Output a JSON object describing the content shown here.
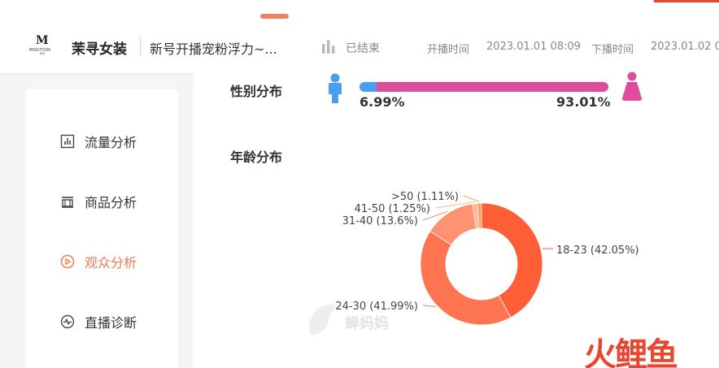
{
  "header": {
    "shop_name": "茉寻女装",
    "live_title": "新号开播宠粉浮力~...",
    "status": "已结束",
    "start_label": "开播时间",
    "start_time": "2023.01.01 08:09",
    "end_label": "下播时间",
    "end_time": "2023.01.02 0",
    "logo_text": "MOUTION",
    "logo_cn": "茉寻"
  },
  "sidebar": {
    "items": [
      {
        "label": "流量分析",
        "icon": "bar-chart-icon"
      },
      {
        "label": "商品分析",
        "icon": "goods-icon"
      },
      {
        "label": "观众分析",
        "icon": "play-circle-icon",
        "active": true
      },
      {
        "label": "直播诊断",
        "icon": "pulse-icon"
      }
    ]
  },
  "gender": {
    "title": "性别分布",
    "male_pct": "6.99%",
    "female_pct": "93.01%",
    "male_value": 6.99,
    "male_color": "#4a9ef0",
    "female_color": "#de4d9b"
  },
  "age": {
    "title": "年龄分布"
  },
  "chart_data": {
    "type": "pie",
    "donut": true,
    "categories": [
      "18-23",
      "24-30",
      "31-40",
      "41-50",
      ">50"
    ],
    "values": [
      42.05,
      41.99,
      13.6,
      1.25,
      1.11
    ],
    "labels": [
      "18-23 (42.05%)",
      "24-30 (41.99%)",
      "31-40 (13.6%)",
      "41-50 (1.25%)",
      ">50 (1.11%)"
    ],
    "colors": [
      "#ff5f37",
      "#ff7551",
      "#ff9272",
      "#ffb597",
      "#ffa05a"
    ]
  },
  "watermark": "蝉妈妈",
  "corner_logo": "火鲤鱼",
  "colors": {
    "accent": "#f07a54",
    "corner_red": "#e8472f"
  }
}
